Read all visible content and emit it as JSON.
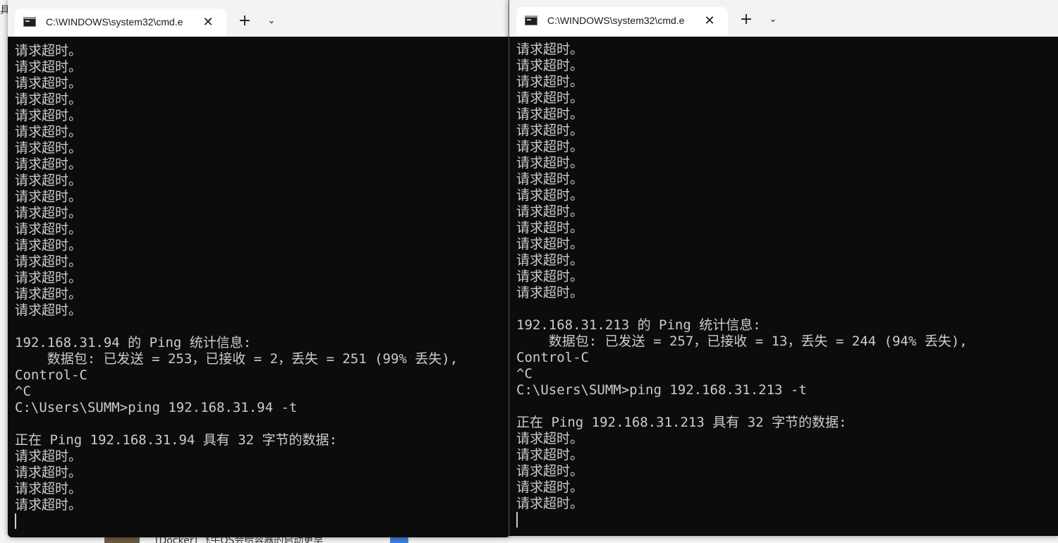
{
  "background": {
    "left_char": "具",
    "bottom_text": "[Docker] 飞牛OS会给容器的启动更早"
  },
  "windows": [
    {
      "tab_title": "C:\\WINDOWS\\system32\\cmd.e",
      "close_glyph": "✕",
      "new_tab_glyph": "+",
      "dropdown_glyph": "⌄",
      "lines": [
        "请求超时。",
        "请求超时。",
        "请求超时。",
        "请求超时。",
        "请求超时。",
        "请求超时。",
        "请求超时。",
        "请求超时。",
        "请求超时。",
        "请求超时。",
        "请求超时。",
        "请求超时。",
        "请求超时。",
        "请求超时。",
        "请求超时。",
        "请求超时。",
        "请求超时。",
        "",
        "192.168.31.94 的 Ping 统计信息:",
        "    数据包: 已发送 = 253，已接收 = 2，丢失 = 251 (99% 丢失),",
        "Control-C",
        "^C",
        "C:\\Users\\SUMM>ping 192.168.31.94 -t",
        "",
        "正在 Ping 192.168.31.94 具有 32 字节的数据:",
        "请求超时。",
        "请求超时。",
        "请求超时。",
        "请求超时。"
      ]
    },
    {
      "tab_title": "C:\\WINDOWS\\system32\\cmd.e",
      "close_glyph": "✕",
      "new_tab_glyph": "+",
      "dropdown_glyph": "⌄",
      "lines": [
        "请求超时。",
        "请求超时。",
        "请求超时。",
        "请求超时。",
        "请求超时。",
        "请求超时。",
        "请求超时。",
        "请求超时。",
        "请求超时。",
        "请求超时。",
        "请求超时。",
        "请求超时。",
        "请求超时。",
        "请求超时。",
        "请求超时。",
        "请求超时。",
        "",
        "192.168.31.213 的 Ping 统计信息:",
        "    数据包: 已发送 = 257，已接收 = 13，丢失 = 244 (94% 丢失),",
        "Control-C",
        "^C",
        "C:\\Users\\SUMM>ping 192.168.31.213 -t",
        "",
        "正在 Ping 192.168.31.213 具有 32 字节的数据:",
        "请求超时。",
        "请求超时。",
        "请求超时。",
        "请求超时。",
        "请求超时。"
      ]
    }
  ]
}
